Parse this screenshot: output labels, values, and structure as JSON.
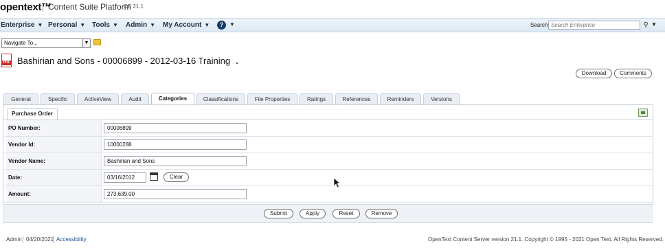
{
  "header": {
    "logo": "opentext™",
    "product": "Content Suite Platform",
    "version": "CE 21.1"
  },
  "menubar": {
    "items": [
      {
        "label": "Enterprise"
      },
      {
        "label": "Personal"
      },
      {
        "label": "Tools"
      },
      {
        "label": "Admin"
      },
      {
        "label": "My Account"
      }
    ],
    "help_icon": "help-circle-icon",
    "search_label": "Search",
    "search_placeholder": "Search Enterprise",
    "search_icon": "magnifier-icon"
  },
  "navigate": {
    "selected": "Navigate To...",
    "folder_icon": "folder-icon"
  },
  "document": {
    "title": "Bashirian and Sons - 00006899 - 2012-03-16 Training",
    "icon": "pdf-icon",
    "actions": {
      "download": "Download",
      "comments": "Comments"
    }
  },
  "tabs": [
    {
      "label": "General"
    },
    {
      "label": "Specific"
    },
    {
      "label": "ActiveView"
    },
    {
      "label": "Audit"
    },
    {
      "label": "Categories",
      "active": true
    },
    {
      "label": "Classifications"
    },
    {
      "label": "File Properties"
    },
    {
      "label": "Ratings"
    },
    {
      "label": "References"
    },
    {
      "label": "Reminders"
    },
    {
      "label": "Versions"
    }
  ],
  "category": {
    "subtab": "Purchase Order",
    "fields": [
      {
        "label": "PO Number:",
        "value": "00006899"
      },
      {
        "label": "Vendor Id:",
        "value": "10000288"
      },
      {
        "label": "Vendor Name:",
        "value": "Bashirian and Sons"
      },
      {
        "label": "Date:",
        "value": "03/16/2012",
        "clear": "Clear"
      },
      {
        "label": "Amount:",
        "value": "273,639.00"
      }
    ],
    "buttons": {
      "submit": "Submit",
      "apply": "Apply",
      "reset": "Reset",
      "remove": "Remove"
    }
  },
  "footer": {
    "user": "Admin",
    "date": "04/20/2021",
    "accessibility": "Accessibility",
    "copyright": "OpenText Content Server version 21.1. Copyright © 1995 - 2021 Open Text. All Rights Reserved."
  },
  "colors": {
    "menubar": "#dde8f3",
    "help": "#123a6b",
    "pdf": "#c62828",
    "link": "#1a4f8c"
  }
}
